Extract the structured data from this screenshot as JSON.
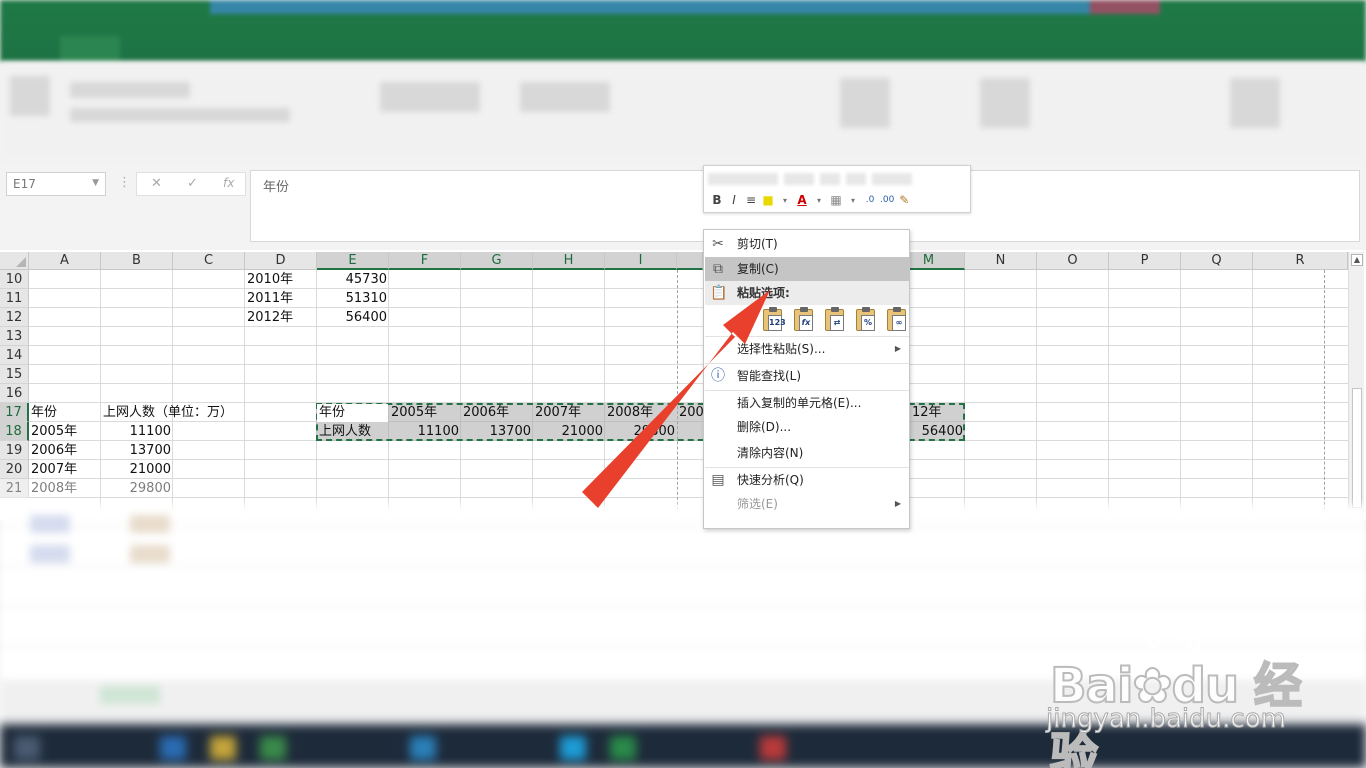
{
  "formula_bar": {
    "name_box": "E17",
    "cancel_icon": "✕",
    "enter_icon": "✓",
    "fx_icon": "fx",
    "content": "年份"
  },
  "mini_toolbar": {
    "bold": "B",
    "italic": "I",
    "align": "≡",
    "fill": "■",
    "font_color": "A",
    "borders": "▦",
    "inc_decimal": ".0",
    "dec_decimal": ".00",
    "brush": "✎"
  },
  "columns": [
    "A",
    "B",
    "C",
    "D",
    "E",
    "F",
    "G",
    "H",
    "I",
    "M",
    "N",
    "O",
    "P",
    "Q",
    "R"
  ],
  "rows": [
    "10",
    "11",
    "12",
    "13",
    "14",
    "15",
    "16",
    "17",
    "18",
    "19",
    "20",
    "21"
  ],
  "cells": {
    "d10": "2010年",
    "e10": "45730",
    "d11": "2011年",
    "e11": "51310",
    "d12": "2012年",
    "e12": "56400",
    "a17": "年份",
    "b17": "上网人数（单位：万）",
    "e17": "年份",
    "f17": "2005年",
    "g17": "2006年",
    "h17": "2007年",
    "i17": "2008年",
    "j17": "200",
    "m17": "12年",
    "a18": "2005年",
    "b18": "11100",
    "e18": "上网人数",
    "f18": "11100",
    "g18": "13700",
    "h18": "21000",
    "i18": "29800",
    "m18": "56400",
    "a19": "2006年",
    "b19": "13700",
    "a20": "2007年",
    "b20": "21000",
    "a21": "2008年",
    "b21": "29800"
  },
  "context_menu": {
    "cut": "剪切(T)",
    "copy": "复制(C)",
    "paste_options": "粘贴选项:",
    "paste_values": "123",
    "paste_formulas": "fx",
    "paste_transpose": "⇄",
    "paste_formatting": "%",
    "paste_link": "∞",
    "paste_special": "选择性粘贴(S)...",
    "smart_lookup": "智能查找(L)",
    "insert_copied": "插入复制的单元格(E)...",
    "delete": "删除(D)...",
    "clear": "清除内容(N)",
    "quick_analysis": "快速分析(Q)",
    "filter": "筛选(E)"
  },
  "watermark": {
    "brand": "Bai✿du 经验",
    "url": "jingyan.baidu.com"
  },
  "colors": {
    "excel_green": "#217346",
    "arrow_red": "#e8402c",
    "selection_gray": "#aaaaaa"
  }
}
